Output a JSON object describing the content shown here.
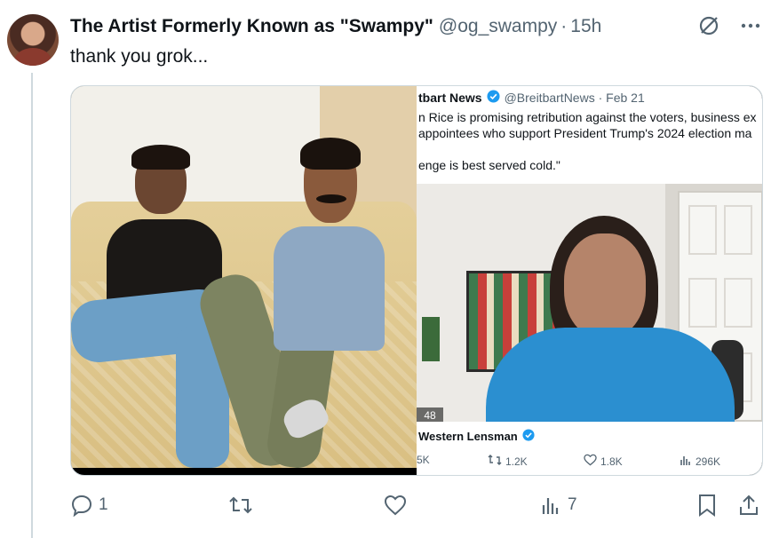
{
  "author": {
    "display_name": "The Artist Formerly Known as \"Swampy\"",
    "handle": "@og_swampy",
    "separator": "·",
    "time": "15h"
  },
  "tweet": {
    "text": "thank you grok..."
  },
  "quoted_post": {
    "source_name": "tbart News",
    "source_handle": "@BreitbartNews · Feb 21",
    "lines": [
      "n Rice is promising retribution against the voters, business ex",
      "appointees who support President  Trump's 2024 election ma",
      "enge is best served cold.\""
    ],
    "video_counter": "48",
    "credit_name": "Western Lensman",
    "stats": {
      "replies": "5K",
      "reposts": "1.2K",
      "likes": "1.8K",
      "views": "296K"
    }
  },
  "actions": {
    "replies": "1",
    "reposts": "",
    "likes": "",
    "views": "7"
  },
  "icons": {
    "top": [
      "grok-icon",
      "more-icon"
    ],
    "actions": [
      "reply-icon",
      "repost-icon",
      "like-icon",
      "views-icon",
      "bookmark-icon",
      "share-icon"
    ]
  },
  "colors": {
    "text": "#0f1419",
    "muted": "#536471",
    "verified": "#1d9bf0",
    "border": "#cfd9de"
  }
}
